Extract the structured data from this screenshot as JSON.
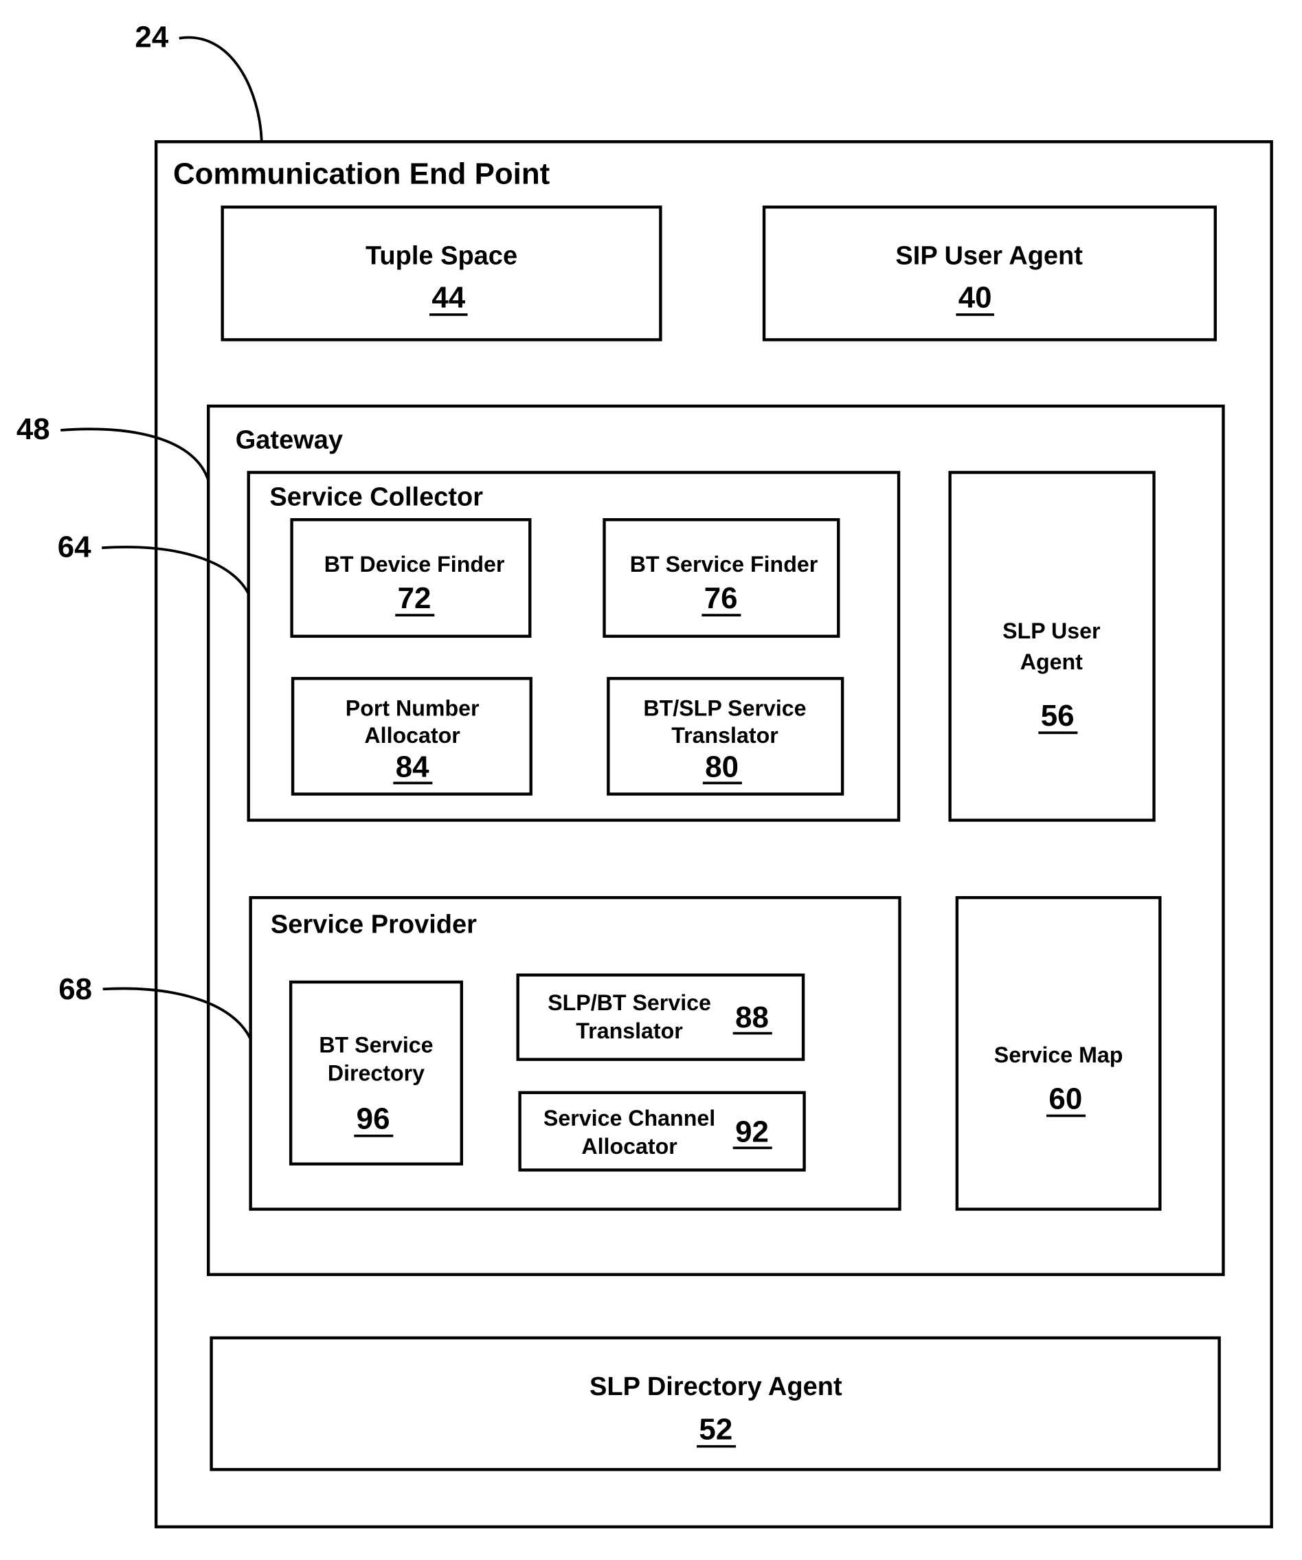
{
  "figure": {
    "reference": "24",
    "title": "Communication End Point"
  },
  "callouts": {
    "endpoint": "24",
    "gateway": "48",
    "service_collector": "64",
    "service_provider": "68"
  },
  "top_row": {
    "tuple_space": {
      "label": "Tuple Space",
      "number": "44"
    },
    "sip_user_agent": {
      "label": "SIP User Agent",
      "number": "40"
    }
  },
  "gateway": {
    "label": "Gateway",
    "service_collector": {
      "label": "Service Collector",
      "bt_device_finder": {
        "label": "BT Device Finder",
        "number": "72"
      },
      "bt_service_finder": {
        "label": "BT Service Finder",
        "number": "76"
      },
      "port_number_allocator": {
        "line1": "Port Number",
        "line2": "Allocator",
        "number": "84"
      },
      "bt_slp_translator": {
        "line1": "BT/SLP Service",
        "line2": "Translator",
        "number": "80"
      }
    },
    "slp_user_agent": {
      "line1": "SLP User",
      "line2": "Agent",
      "number": "56"
    },
    "service_provider": {
      "label": "Service Provider",
      "bt_service_directory": {
        "line1": "BT Service",
        "line2": "Directory",
        "number": "96"
      },
      "slp_bt_translator": {
        "line1": "SLP/BT Service",
        "line2": "Translator",
        "number": "88"
      },
      "service_channel_allocator": {
        "line1": "Service Channel",
        "line2": "Allocator",
        "number": "92"
      }
    },
    "service_map": {
      "label": "Service Map",
      "number": "60"
    }
  },
  "slp_directory_agent": {
    "label": "SLP Directory Agent",
    "number": "52"
  }
}
